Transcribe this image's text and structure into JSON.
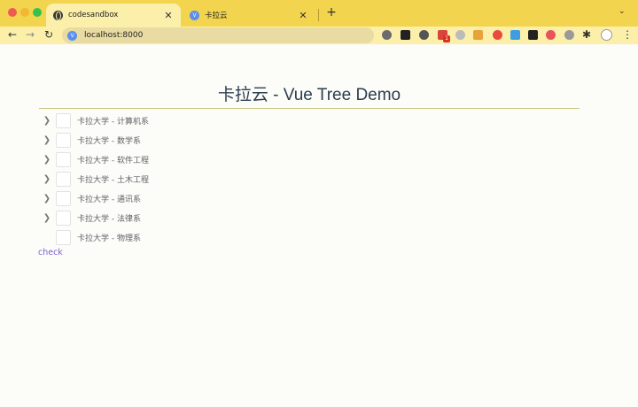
{
  "browser": {
    "tabs": [
      {
        "title": "codesandbox",
        "close": "✕"
      },
      {
        "title": "卡拉云",
        "close": "✕"
      }
    ],
    "new_tab": "+",
    "tabs_menu": "⌄",
    "nav": {
      "back": "←",
      "forward": "→",
      "reload": "↻"
    },
    "address": "localhost:8000",
    "extension_badge": "1",
    "favicon_vue_glyph": "V"
  },
  "page": {
    "title": "卡拉云 - Vue Tree Demo",
    "tree": [
      {
        "label": "卡拉大学 - 计算机系",
        "expandable": true
      },
      {
        "label": "卡拉大学 - 数学系",
        "expandable": true
      },
      {
        "label": "卡拉大学 - 软件工程",
        "expandable": true
      },
      {
        "label": "卡拉大学 - 土木工程",
        "expandable": true
      },
      {
        "label": "卡拉大学 - 通讯系",
        "expandable": true
      },
      {
        "label": "卡拉大学 - 法律系",
        "expandable": true
      },
      {
        "label": "卡拉大学 - 物理系",
        "expandable": false
      }
    ],
    "check_link": "check"
  },
  "colors": {
    "titlebar": "#f2d44e",
    "toolbar": "#fbefa9",
    "link": "#7b63d1",
    "title_text": "#2c3e50"
  }
}
